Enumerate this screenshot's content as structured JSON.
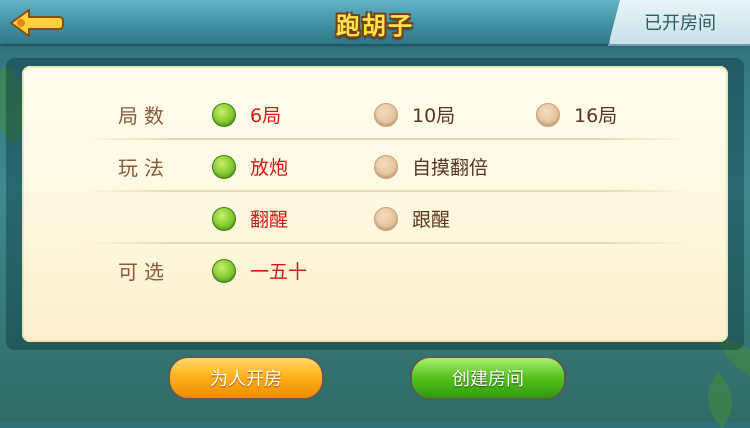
{
  "header": {
    "title": "跑胡子",
    "opened_rooms_label": "已开房间"
  },
  "rows": {
    "rounds": {
      "label": "局数",
      "options": [
        {
          "label": "6局",
          "selected": true
        },
        {
          "label": "10局",
          "selected": false
        },
        {
          "label": "16局",
          "selected": false
        }
      ]
    },
    "play": {
      "label": "玩法",
      "options": [
        {
          "label": "放炮",
          "selected": true
        },
        {
          "label": "自摸翻倍",
          "selected": false
        },
        {
          "label": "翻醒",
          "selected": true
        },
        {
          "label": "跟醒",
          "selected": false
        }
      ]
    },
    "optional": {
      "label": "可选",
      "options": [
        {
          "label": "一五十",
          "selected": true
        }
      ]
    }
  },
  "buttons": {
    "create_for_others": "为人开房",
    "create_room": "创建房间"
  },
  "icons": {
    "back": "back-arrow-icon",
    "selected": "radio-selected-icon",
    "unselected": "radio-unselected-icon"
  },
  "colors": {
    "selected_text": "#d21a1a",
    "unselected_text": "#5a3520",
    "title": "#ffe34a",
    "label": "#8a5a3c"
  }
}
